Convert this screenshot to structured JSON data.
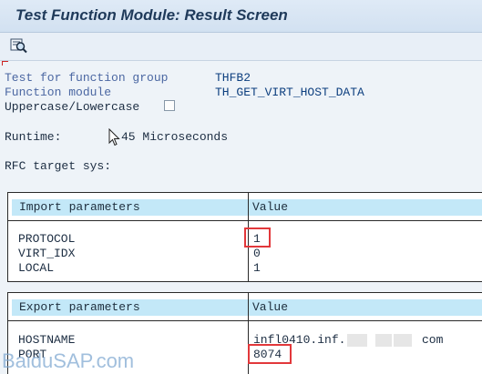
{
  "window": {
    "title": "Test Function Module: Result Screen"
  },
  "toolbar": {
    "buttons": [
      {
        "icon": "display-detail-icon"
      }
    ]
  },
  "header_fields": {
    "function_group_label": "Test for function group",
    "function_group_value": "THFB2",
    "function_module_label": "Function module",
    "function_module_value": "TH_GET_VIRT_HOST_DATA",
    "case_label": "Uppercase/Lowercase",
    "case_checked": false,
    "runtime_label": "Runtime:",
    "runtime_value": "45 Microseconds",
    "rfc_label": "RFC target sys:"
  },
  "import_table": {
    "col_name": "Import parameters",
    "col_value": "Value",
    "rows": [
      {
        "name": "PROTOCOL",
        "value": "1"
      },
      {
        "name": "VIRT_IDX",
        "value": "0"
      },
      {
        "name": "LOCAL",
        "value": "1"
      }
    ]
  },
  "export_table": {
    "col_name": "Export parameters",
    "col_value": "Value",
    "rows": [
      {
        "name": "HOSTNAME",
        "value_prefix": "infl0410.inf.",
        "value_suffix": "com"
      },
      {
        "name": "PORT",
        "value": "8074"
      }
    ]
  },
  "watermark": {
    "text": "BaiduSAP.com"
  },
  "colors": {
    "table_header_bg": "#c3e8f8",
    "highlight_box": "#e2383b",
    "label_blue": "#4b67a2",
    "value_blue": "#0d3f7f"
  }
}
